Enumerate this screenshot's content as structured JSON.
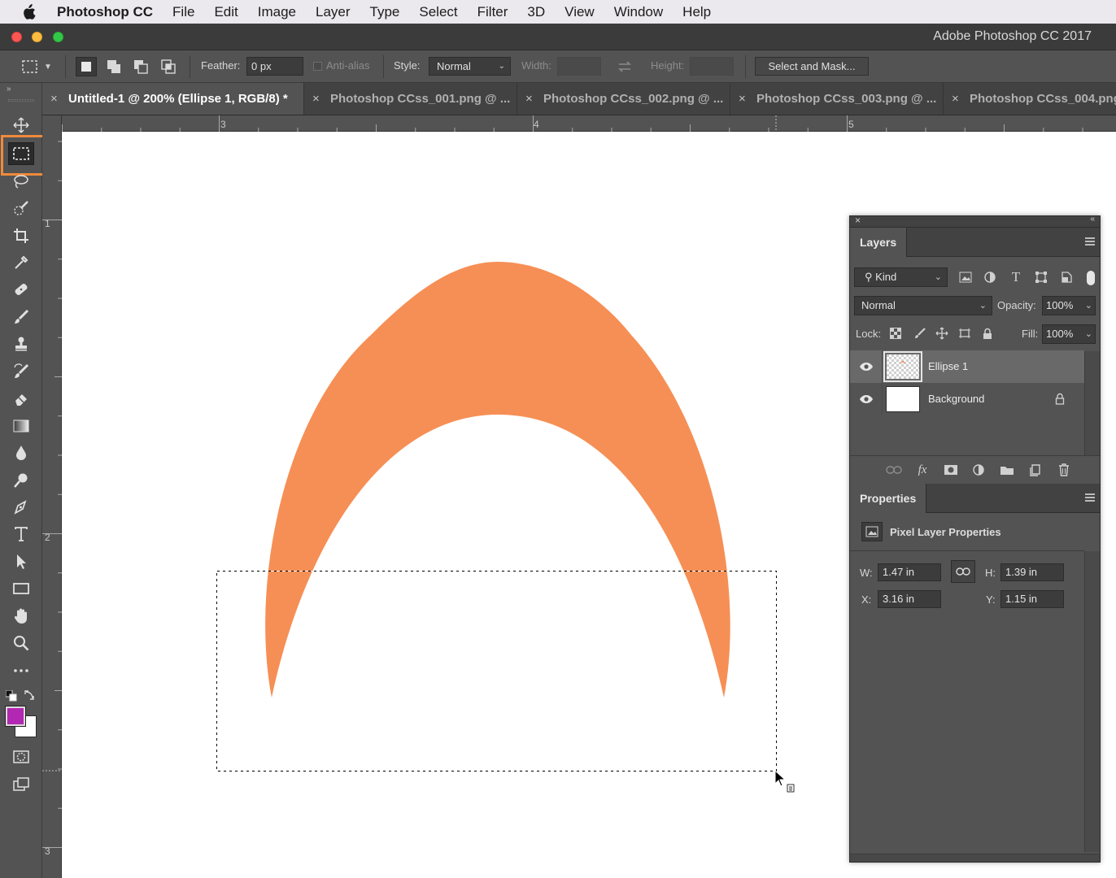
{
  "menubar": {
    "app_name": "Photoshop CC",
    "items": [
      "File",
      "Edit",
      "Image",
      "Layer",
      "Type",
      "Select",
      "Filter",
      "3D",
      "View",
      "Window",
      "Help"
    ]
  },
  "window": {
    "title": "Adobe Photoshop CC 2017"
  },
  "options": {
    "feather_label": "Feather:",
    "feather_value": "0 px",
    "antialias_label": "Anti-alias",
    "style_label": "Style:",
    "style_value": "Normal",
    "width_label": "Width:",
    "height_label": "Height:",
    "select_mask_label": "Select and Mask..."
  },
  "tabs": [
    {
      "label": "Untitled-1 @ 200% (Ellipse 1, RGB/8) *",
      "active": true
    },
    {
      "label": "Photoshop CCss_001.png @ ...",
      "active": false
    },
    {
      "label": "Photoshop CCss_002.png @ ...",
      "active": false
    },
    {
      "label": "Photoshop CCss_003.png @ ...",
      "active": false
    },
    {
      "label": "Photoshop CCss_004.png",
      "active": false
    }
  ],
  "rulers": {
    "top": [
      "3",
      "4",
      "5"
    ],
    "left": [
      "1",
      "2",
      "3"
    ]
  },
  "colors": {
    "shape_fill": "#f68f55",
    "foreground": "#b228b2",
    "background": "#ffffff",
    "tool_highlight": "#f08a3c"
  },
  "layers_panel": {
    "title": "Layers",
    "kind_label": "Kind",
    "blend_mode": "Normal",
    "opacity_label": "Opacity:",
    "opacity_value": "100%",
    "lock_label": "Lock:",
    "fill_label": "Fill:",
    "fill_value": "100%",
    "layers": [
      {
        "name": "Ellipse 1",
        "selected": true
      },
      {
        "name": "Background",
        "selected": false
      }
    ]
  },
  "properties_panel": {
    "title": "Properties",
    "subtitle": "Pixel Layer Properties",
    "w_label": "W:",
    "w_value": "1.47 in",
    "h_label": "H:",
    "h_value": "1.39 in",
    "x_label": "X:",
    "x_value": "3.16 in",
    "y_label": "Y:",
    "y_value": "1.15 in"
  }
}
